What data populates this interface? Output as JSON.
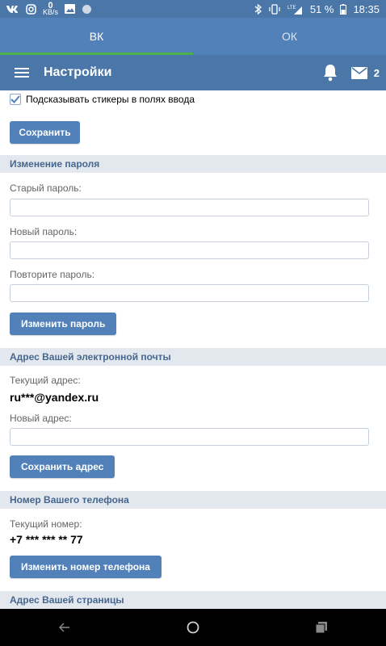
{
  "status_bar": {
    "icons_left": [
      "vk-icon",
      "instagram-icon",
      "image-icon",
      "circle-icon"
    ],
    "net_speed": {
      "value": "0",
      "unit": "KB/s"
    },
    "icons_right": [
      "bluetooth-icon",
      "vibrate-icon",
      "lte-icon",
      "signal-icon"
    ],
    "battery": "51 %",
    "time": "18:35"
  },
  "tabs": [
    {
      "label": "ВК",
      "active": true
    },
    {
      "label": "ОК",
      "active": false
    }
  ],
  "header": {
    "title": "Настройки",
    "mail_count": "2"
  },
  "settings": {
    "stickers_checkbox_label": "Подсказывать стикеры в полях ввода",
    "stickers_checked": true,
    "save_button": "Сохранить"
  },
  "password_section": {
    "title": "Изменение пароля",
    "old_label": "Старый пароль:",
    "new_label": "Новый пароль:",
    "repeat_label": "Повторите пароль:",
    "change_button": "Изменить пароль"
  },
  "email_section": {
    "title": "Адрес Вашей электронной почты",
    "current_label": "Текущий адрес:",
    "current_value": "ru***@yandex.ru",
    "new_label": "Новый адрес:",
    "save_button": "Сохранить адрес"
  },
  "phone_section": {
    "title": "Номер Вашего телефона",
    "current_label": "Текущий номер:",
    "current_value": "+7 *** *** ** 77",
    "change_button": "Изменить номер телефона"
  },
  "page_section": {
    "title": "Адрес Вашей страницы"
  },
  "colors": {
    "brand": "#4a76a8",
    "button": "#5181b8",
    "tab_indicator": "#4bb34b",
    "section_bg": "#e3e8ee",
    "section_text": "#45678f"
  }
}
